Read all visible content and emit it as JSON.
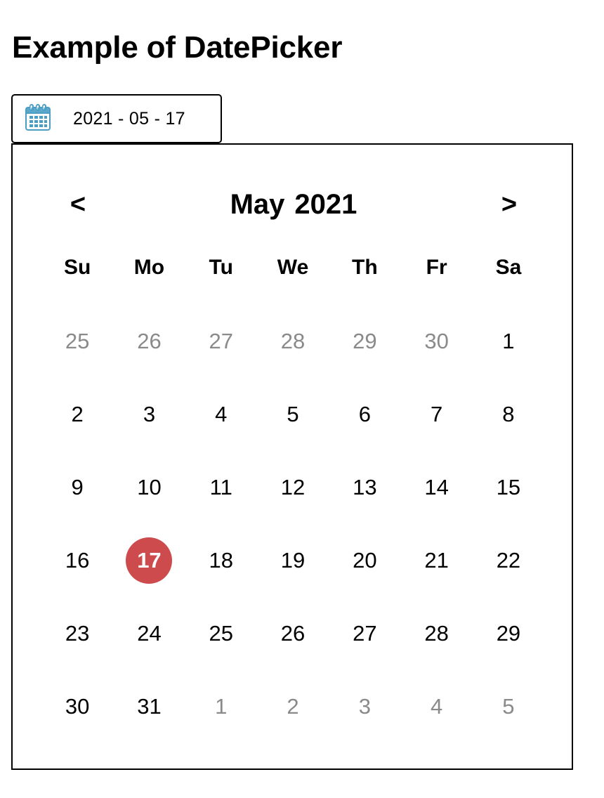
{
  "page": {
    "title": "Example of DatePicker"
  },
  "date_input": {
    "value": "2021 - 05 - 17",
    "icon": "calendar-icon",
    "icon_color": "#4a9ec4"
  },
  "calendar": {
    "prev_label": "<",
    "next_label": ">",
    "month": "May",
    "year": "2021",
    "weekdays": [
      "Su",
      "Mo",
      "Tu",
      "We",
      "Th",
      "Fr",
      "Sa"
    ],
    "selected_color": "#cd4a4d",
    "days": [
      {
        "label": "25",
        "muted": true
      },
      {
        "label": "26",
        "muted": true
      },
      {
        "label": "27",
        "muted": true
      },
      {
        "label": "28",
        "muted": true
      },
      {
        "label": "29",
        "muted": true
      },
      {
        "label": "30",
        "muted": true
      },
      {
        "label": "1",
        "muted": false
      },
      {
        "label": "2",
        "muted": false
      },
      {
        "label": "3",
        "muted": false
      },
      {
        "label": "4",
        "muted": false
      },
      {
        "label": "5",
        "muted": false
      },
      {
        "label": "6",
        "muted": false
      },
      {
        "label": "7",
        "muted": false
      },
      {
        "label": "8",
        "muted": false
      },
      {
        "label": "9",
        "muted": false
      },
      {
        "label": "10",
        "muted": false
      },
      {
        "label": "11",
        "muted": false
      },
      {
        "label": "12",
        "muted": false
      },
      {
        "label": "13",
        "muted": false
      },
      {
        "label": "14",
        "muted": false
      },
      {
        "label": "15",
        "muted": false
      },
      {
        "label": "16",
        "muted": false
      },
      {
        "label": "17",
        "muted": false,
        "selected": true
      },
      {
        "label": "18",
        "muted": false
      },
      {
        "label": "19",
        "muted": false
      },
      {
        "label": "20",
        "muted": false
      },
      {
        "label": "21",
        "muted": false
      },
      {
        "label": "22",
        "muted": false
      },
      {
        "label": "23",
        "muted": false
      },
      {
        "label": "24",
        "muted": false
      },
      {
        "label": "25",
        "muted": false
      },
      {
        "label": "26",
        "muted": false
      },
      {
        "label": "27",
        "muted": false
      },
      {
        "label": "28",
        "muted": false
      },
      {
        "label": "29",
        "muted": false
      },
      {
        "label": "30",
        "muted": false
      },
      {
        "label": "31",
        "muted": false
      },
      {
        "label": "1",
        "muted": true
      },
      {
        "label": "2",
        "muted": true
      },
      {
        "label": "3",
        "muted": true
      },
      {
        "label": "4",
        "muted": true
      },
      {
        "label": "5",
        "muted": true
      }
    ]
  }
}
